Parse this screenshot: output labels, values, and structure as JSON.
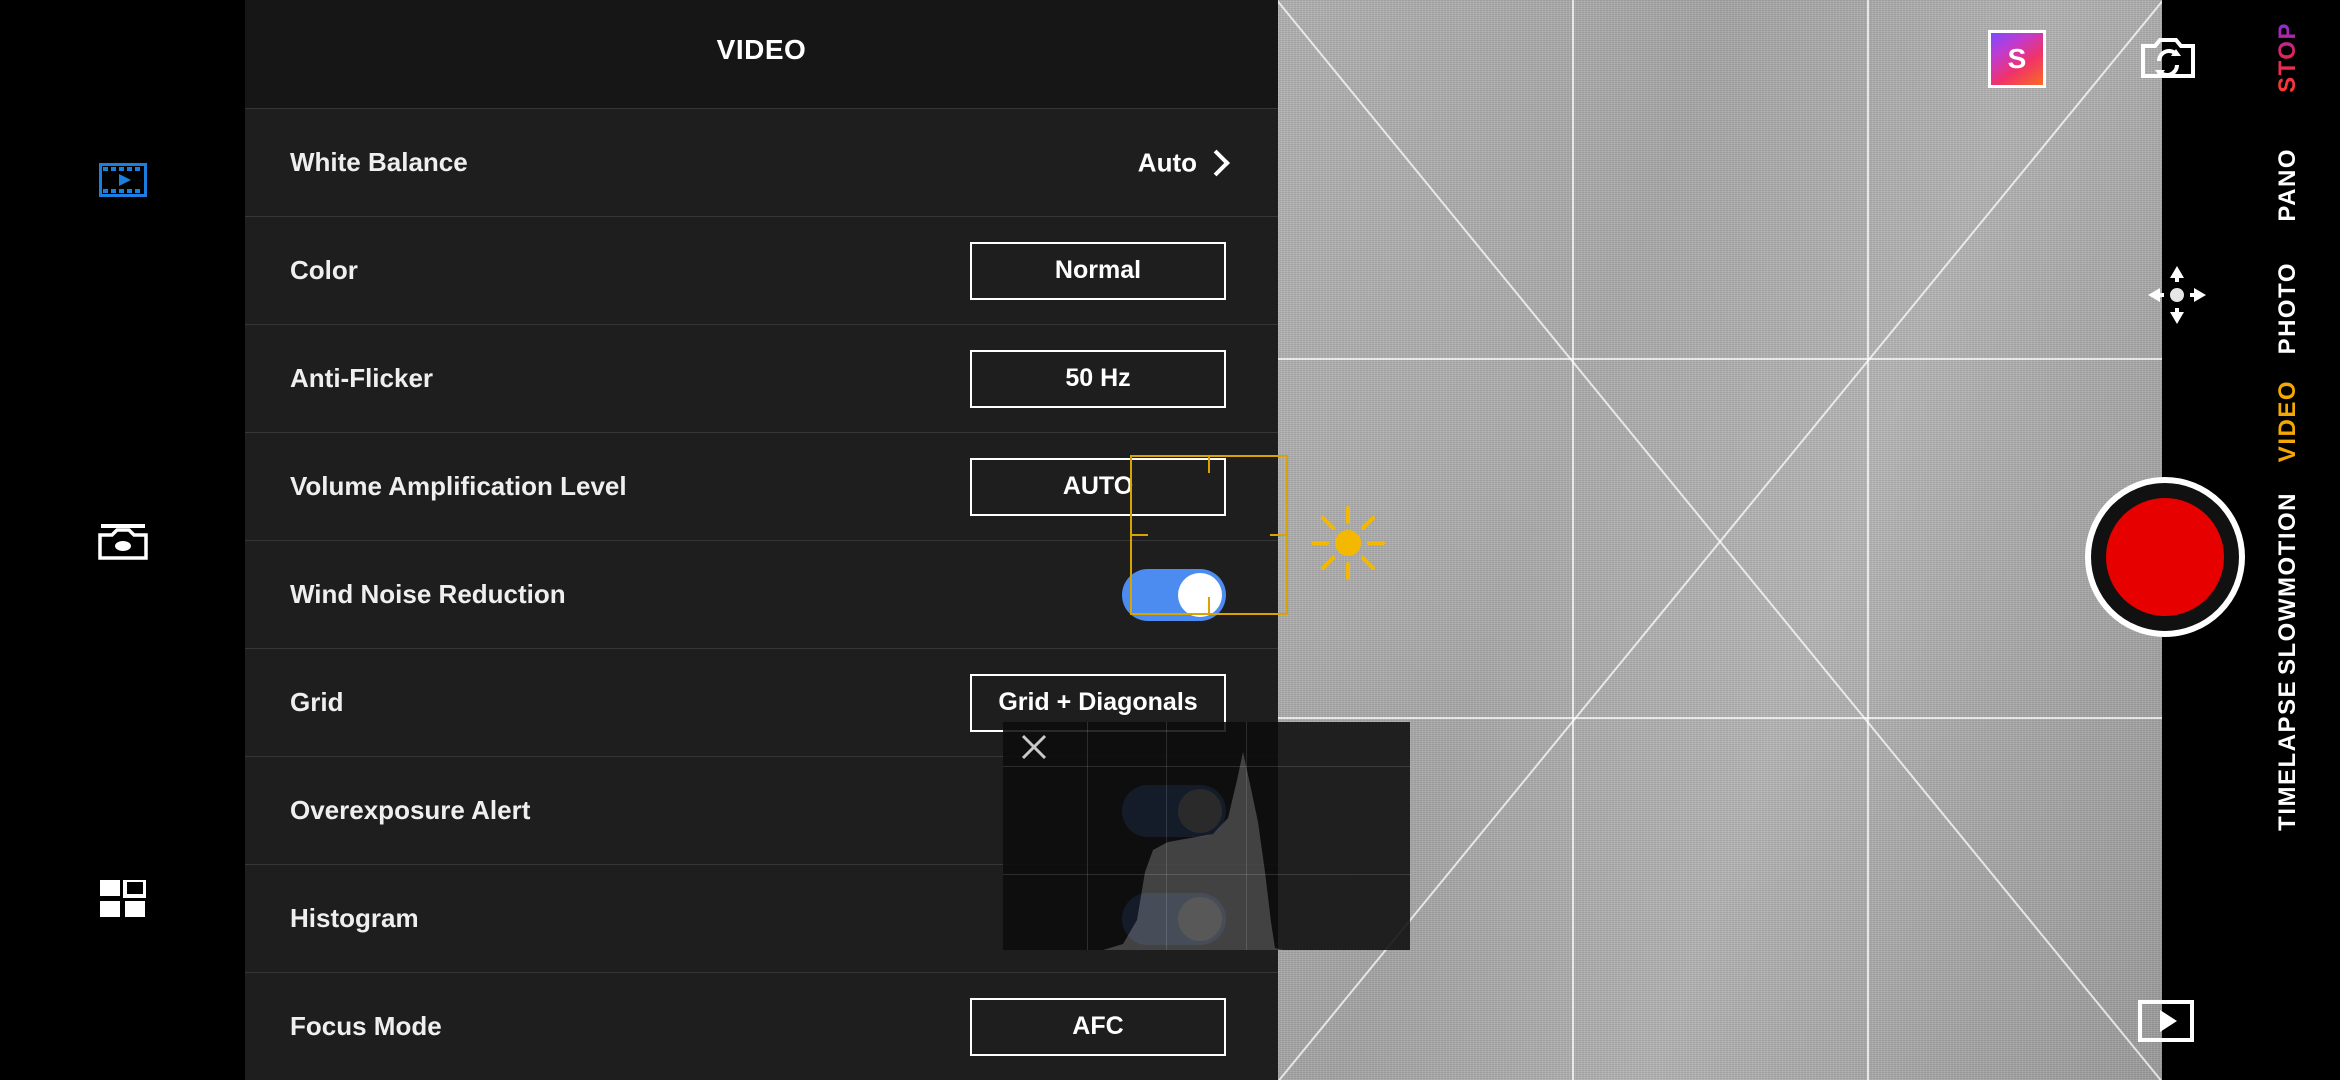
{
  "app": {
    "panel_title": "VIDEO"
  },
  "left_rail": {
    "items": [
      {
        "name": "video-mode-icon",
        "label": "Video"
      },
      {
        "name": "camera-mode-icon",
        "label": "Camera"
      },
      {
        "name": "apps-grid-icon",
        "label": "Grid"
      }
    ]
  },
  "settings": {
    "rows": [
      {
        "label": "White Balance",
        "value": "Auto",
        "type": "link"
      },
      {
        "label": "Color",
        "value": "Normal",
        "type": "box"
      },
      {
        "label": "Anti-Flicker",
        "value": "50 Hz",
        "type": "box"
      },
      {
        "label": "Volume Amplification Level",
        "value": "AUTO",
        "type": "box"
      },
      {
        "label": "Wind Noise Reduction",
        "value": "on",
        "type": "toggle"
      },
      {
        "label": "Grid",
        "value": "Grid + Diagonals",
        "type": "box"
      },
      {
        "label": "Overexposure Alert",
        "value": "on",
        "type": "toggle"
      },
      {
        "label": "Histogram",
        "value": "on",
        "type": "toggle"
      },
      {
        "label": "Focus Mode",
        "value": "AFC",
        "type": "box"
      }
    ]
  },
  "modes": {
    "items": [
      {
        "label": "STOP",
        "active": false,
        "style": "gradient"
      },
      {
        "label": "PANO",
        "active": false,
        "style": "plain"
      },
      {
        "label": "PHOTO",
        "active": false,
        "style": "plain"
      },
      {
        "label": "VIDEO",
        "active": true,
        "style": "plain"
      },
      {
        "label": "SLOWMOTION",
        "active": false,
        "style": "plain"
      },
      {
        "label": "TIMELAPSE",
        "active": false,
        "style": "plain"
      }
    ]
  },
  "viewfinder": {
    "watermark_badge": "S",
    "grid_mode": "Grid + Diagonals",
    "controls": {
      "flip_camera": "flip-camera",
      "collapse": "collapse-center",
      "gallery": "gallery",
      "record": "record",
      "exposure": "exposure-sun"
    }
  },
  "colors": {
    "accent_toggle": "#4c8cf0",
    "record_red": "#e60000",
    "mode_active": "#f5a800",
    "focus_yellow": "#d8a400",
    "panel_bg": "#202020"
  }
}
